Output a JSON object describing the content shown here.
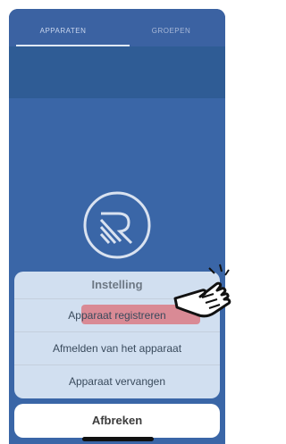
{
  "tabs": [
    {
      "label": "APPARATEN",
      "active": true
    },
    {
      "label": "GROEPEN",
      "active": false
    }
  ],
  "action_sheet": {
    "title": "Instelling",
    "options": [
      {
        "label": "Apparaat registreren",
        "highlighted": true
      },
      {
        "label": "Afmelden van het apparaat"
      },
      {
        "label": "Apparaat vervangen"
      }
    ],
    "cancel_label": "Afbreken"
  },
  "colors": {
    "tab_bar": "#3b62a2",
    "background": "#3a66a7",
    "highlight": "#d98a95"
  },
  "icons": {
    "logo": "brand-logo-icon",
    "pointer": "pointing-hand-icon"
  }
}
